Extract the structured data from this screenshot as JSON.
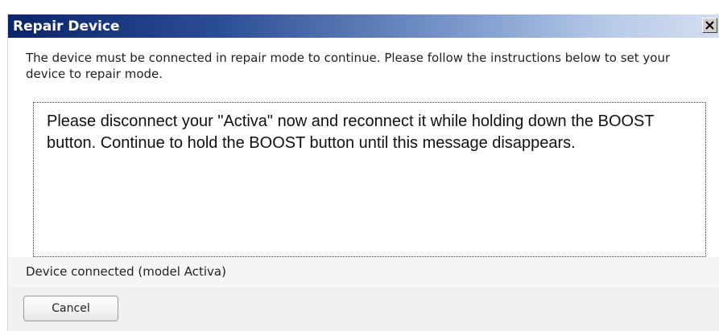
{
  "dialog": {
    "title": "Repair Device",
    "close_icon": "close-icon",
    "intro_text": "The device must be connected in repair mode to continue. Please follow the instructions below to set your device to repair mode.",
    "message_text": "Please disconnect your \"Activa\" now and reconnect it while holding down the BOOST button. Continue to hold the BOOST button until this message disappears.",
    "status_text": "Device connected (model Activa)",
    "cancel_label": "Cancel"
  }
}
